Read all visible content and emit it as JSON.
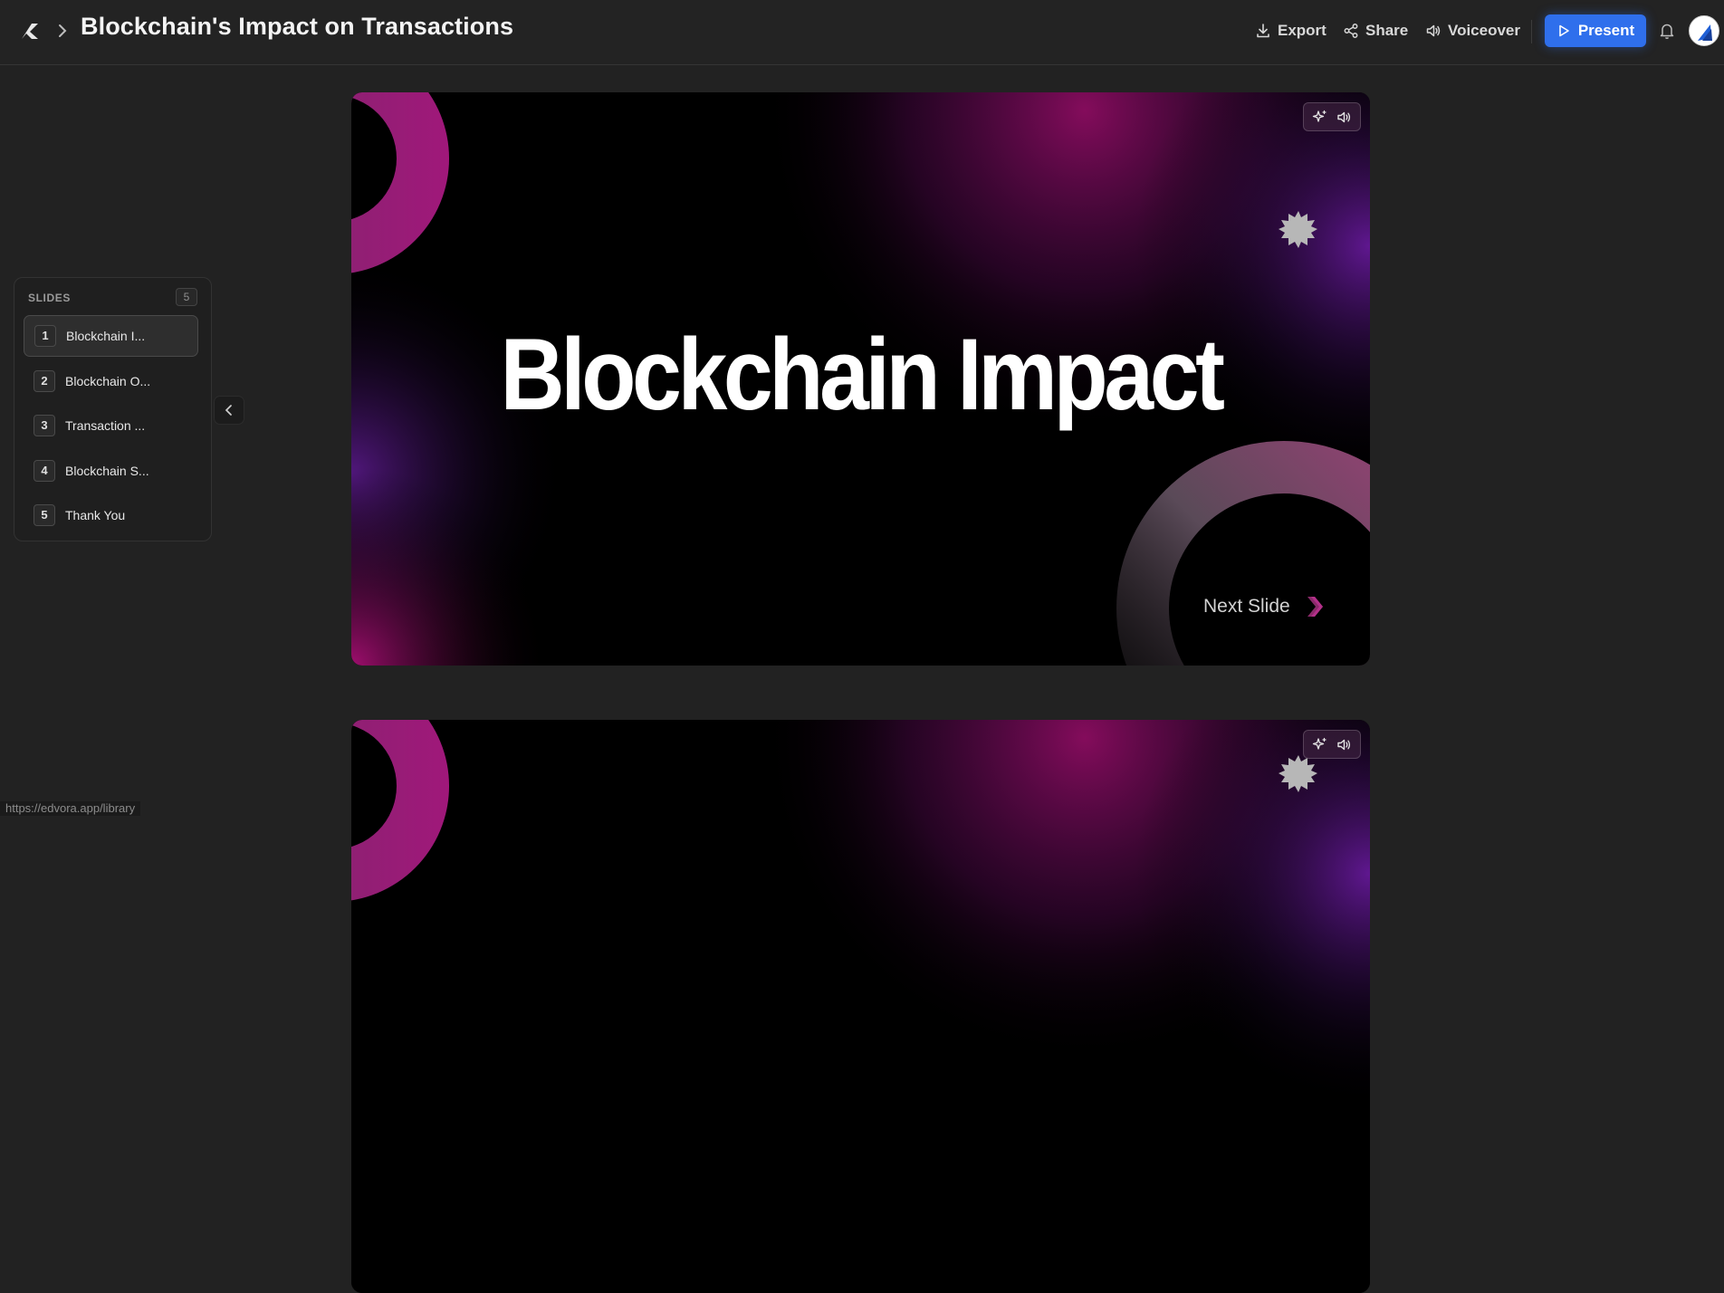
{
  "header": {
    "title": "Blockchain's Impact on Transactions",
    "export_label": "Export",
    "share_label": "Share",
    "voiceover_label": "Voiceover",
    "present_label": "Present"
  },
  "sidebar": {
    "heading": "SLIDES",
    "count": "5",
    "items": [
      {
        "number": "1",
        "label": "Blockchain I...",
        "active": true
      },
      {
        "number": "2",
        "label": "Blockchain O...",
        "active": false
      },
      {
        "number": "3",
        "label": "Transaction ...",
        "active": false
      },
      {
        "number": "4",
        "label": "Blockchain S...",
        "active": false
      },
      {
        "number": "5",
        "label": "Thank You",
        "active": false
      }
    ]
  },
  "slides": [
    {
      "title": "Blockchain Impact",
      "next_label": "Next Slide"
    },
    {
      "title": "",
      "next_label": ""
    }
  ],
  "status_bar": {
    "url": "https://edvora.app/library"
  },
  "colors": {
    "accent": "#2f6fec",
    "background": "#222222",
    "slide_magenta": "#b0107a",
    "slide_purple": "#6a1aa0"
  },
  "icons": [
    "logo-icon",
    "chevron-right-icon",
    "download-icon",
    "share-icon",
    "speaker-icon",
    "play-icon",
    "bell-icon",
    "sparkle-icon",
    "chevron-left-icon",
    "next-arrow-icon"
  ]
}
